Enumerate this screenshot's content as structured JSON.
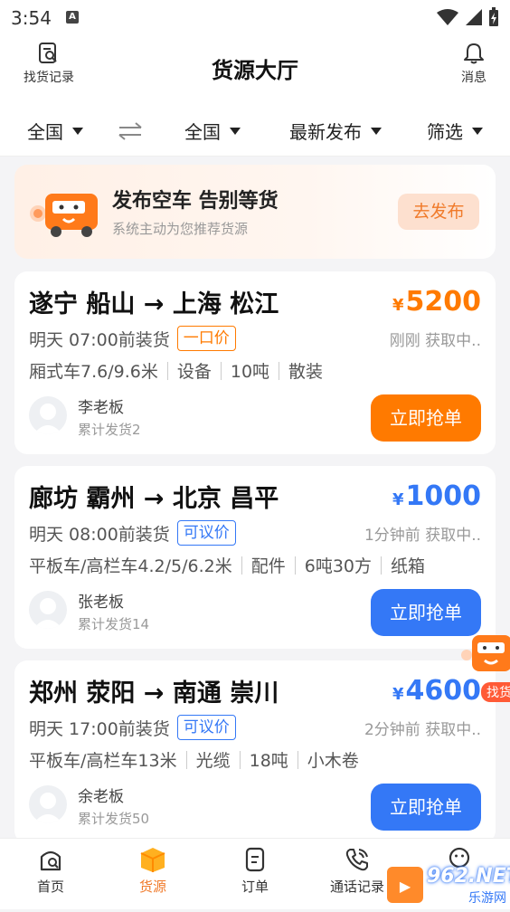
{
  "status_bar": {
    "time": "3:54",
    "badge": "A"
  },
  "header": {
    "title": "货源大厅",
    "left_label": "找货记录",
    "right_label": "消息"
  },
  "filters": {
    "from": "全国",
    "to": "全国",
    "sort": "最新发布",
    "filter": "筛选"
  },
  "banner": {
    "title": "发布空车 告别等货",
    "subtitle": "系统主动为您推荐货源",
    "button": "去发布"
  },
  "colors": {
    "orange": "#ff7a00",
    "blue": "#3478f6",
    "accent": "#f07a2a"
  },
  "cards": [
    {
      "route": "遂宁 船山 → 上海 松江",
      "price": "5200",
      "yen": "¥",
      "load": "明天 07:00前装货",
      "tag": "一口价",
      "ago": "刚刚 获取中..",
      "specs": [
        "厢式车7.6/9.6米",
        "设备",
        "10吨",
        "散装"
      ],
      "owner": "李老板",
      "count": "累计发货2",
      "button": "立即抢单"
    },
    {
      "route": "廊坊 霸州 → 北京 昌平",
      "price": "1000",
      "yen": "¥",
      "load": "明天 08:00前装货",
      "tag": "可议价",
      "ago": "1分钟前 获取中..",
      "specs": [
        "平板车/高栏车4.2/5/6.2米",
        "配件",
        "6吨30方",
        "纸箱"
      ],
      "owner": "张老板",
      "count": "累计发货14",
      "button": "立即抢单"
    },
    {
      "route": "郑州 荥阳 → 南通 崇川",
      "price": "4600",
      "yen": "¥",
      "load": "明天 17:00前装货",
      "tag": "可议价",
      "ago": "2分钟前 获取中..",
      "specs": [
        "平板车/高栏车13米",
        "光缆",
        "18吨",
        "小木卷"
      ],
      "owner": "余老板",
      "count": "累计发货50",
      "button": "立即抢单"
    }
  ],
  "float_label": "找货",
  "tabs": [
    {
      "label": "首页"
    },
    {
      "label": "货源"
    },
    {
      "label": "订单"
    },
    {
      "label": "通话记录"
    },
    {
      "label": ""
    }
  ],
  "watermark": {
    "text": "962.NET",
    "sub": "乐游网"
  }
}
